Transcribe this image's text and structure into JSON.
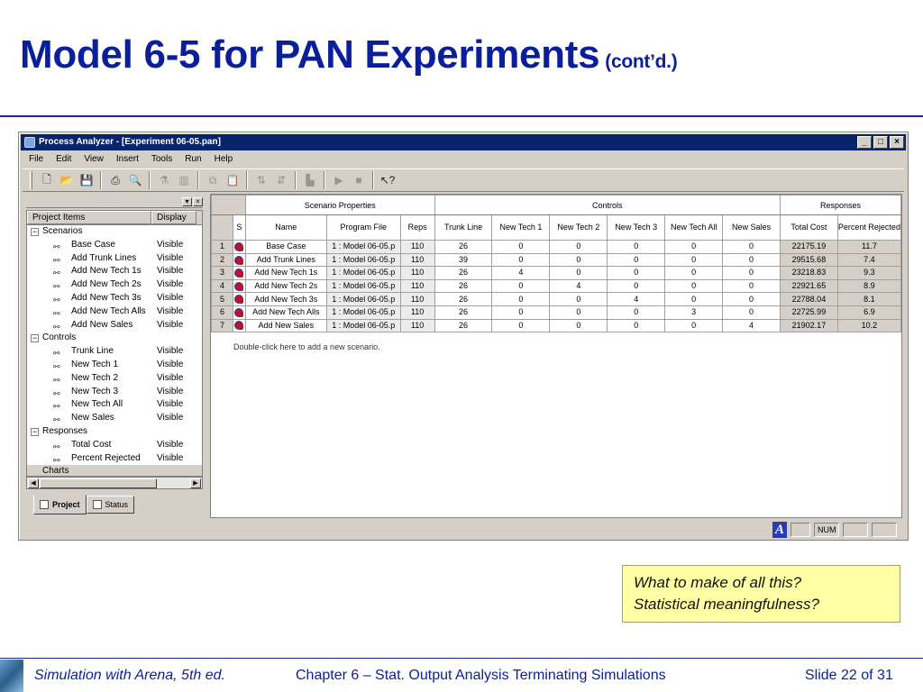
{
  "slide": {
    "title": "Model 6-5 for PAN Experiments",
    "title_suffix": "(cont’d.)"
  },
  "window": {
    "title": "Process Analyzer - [Experiment 06-05.pan]",
    "controls": {
      "minimize": "_",
      "maximize": "□",
      "close": "×"
    },
    "menu": [
      "File",
      "Edit",
      "View",
      "Insert",
      "Tools",
      "Run",
      "Help"
    ]
  },
  "toolbar": {
    "icons": [
      "new-icon",
      "open-icon",
      "save-icon",
      "print-icon",
      "print-preview-icon",
      "chart-wizard-icon",
      "insert-chart-icon",
      "copy-icon",
      "paste-icon",
      "sort-ascending-icon",
      "sort-descending-icon",
      "best-scenarios-icon",
      "run-icon",
      "stop-icon",
      "help-cursor-icon"
    ]
  },
  "project_tree": {
    "header": {
      "items": "Project Items",
      "display": "Display"
    },
    "groups": [
      {
        "label": "Scenarios",
        "items": [
          {
            "label": "Base Case",
            "display": "Visible"
          },
          {
            "label": "Add Trunk Lines",
            "display": "Visible"
          },
          {
            "label": "Add New Tech 1s",
            "display": "Visible"
          },
          {
            "label": "Add New Tech 2s",
            "display": "Visible"
          },
          {
            "label": "Add New Tech 3s",
            "display": "Visible"
          },
          {
            "label": "Add New Tech Alls",
            "display": "Visible"
          },
          {
            "label": "Add New Sales",
            "display": "Visible"
          }
        ]
      },
      {
        "label": "Controls",
        "items": [
          {
            "label": "Trunk Line",
            "display": "Visible"
          },
          {
            "label": "New Tech 1",
            "display": "Visible"
          },
          {
            "label": "New Tech 2",
            "display": "Visible"
          },
          {
            "label": "New Tech 3",
            "display": "Visible"
          },
          {
            "label": "New Tech All",
            "display": "Visible"
          },
          {
            "label": "New Sales",
            "display": "Visible"
          }
        ]
      },
      {
        "label": "Responses",
        "items": [
          {
            "label": "Total Cost",
            "display": "Visible"
          },
          {
            "label": "Percent Rejected",
            "display": "Visible"
          }
        ]
      }
    ],
    "charts_label": "Charts",
    "tabs": [
      "Project",
      "Status"
    ]
  },
  "grid": {
    "groups": {
      "scenario": "Scenario Properties",
      "controls": "Controls",
      "responses": "Responses"
    },
    "columns": [
      "S",
      "Name",
      "Program File",
      "Reps",
      "Trunk Line",
      "New Tech 1",
      "New Tech 2",
      "New Tech 3",
      "New Tech All",
      "New Sales",
      "Total Cost",
      "Percent Rejected"
    ],
    "rows": [
      {
        "n": "1",
        "name": "Base Case",
        "file": "1 : Model 06-05.p",
        "reps": "110",
        "trunk": "26",
        "t1": "0",
        "t2": "0",
        "t3": "0",
        "tall": "0",
        "sales": "0",
        "cost": "22175.19",
        "pct": "11.7"
      },
      {
        "n": "2",
        "name": "Add Trunk Lines",
        "file": "1 : Model 06-05.p",
        "reps": "110",
        "trunk": "39",
        "t1": "0",
        "t2": "0",
        "t3": "0",
        "tall": "0",
        "sales": "0",
        "cost": "29515.68",
        "pct": "7.4"
      },
      {
        "n": "3",
        "name": "Add New Tech 1s",
        "file": "1 : Model 06-05.p",
        "reps": "110",
        "trunk": "26",
        "t1": "4",
        "t2": "0",
        "t3": "0",
        "tall": "0",
        "sales": "0",
        "cost": "23218.83",
        "pct": "9.3"
      },
      {
        "n": "4",
        "name": "Add New Tech 2s",
        "file": "1 : Model 06-05.p",
        "reps": "110",
        "trunk": "26",
        "t1": "0",
        "t2": "4",
        "t3": "0",
        "tall": "0",
        "sales": "0",
        "cost": "22921.65",
        "pct": "8.9"
      },
      {
        "n": "5",
        "name": "Add New Tech 3s",
        "file": "1 : Model 06-05.p",
        "reps": "110",
        "trunk": "26",
        "t1": "0",
        "t2": "0",
        "t3": "4",
        "tall": "0",
        "sales": "0",
        "cost": "22788.04",
        "pct": "8.1"
      },
      {
        "n": "6",
        "name": "Add New Tech Alls",
        "file": "1 : Model 06-05.p",
        "reps": "110",
        "trunk": "26",
        "t1": "0",
        "t2": "0",
        "t3": "0",
        "tall": "3",
        "sales": "0",
        "cost": "22725.99",
        "pct": "6.9"
      },
      {
        "n": "7",
        "name": "Add New Sales",
        "file": "1 : Model 06-05.p",
        "reps": "110",
        "trunk": "26",
        "t1": "0",
        "t2": "0",
        "t3": "0",
        "tall": "0",
        "sales": "4",
        "cost": "21902.17",
        "pct": "10.2"
      }
    ],
    "hint": "Double-click here to add a new scenario."
  },
  "statusbar": {
    "font_indicator": "A",
    "num": "NUM"
  },
  "callout": {
    "line1": "What to make of all this?",
    "line2": "Statistical meaningfulness?"
  },
  "footer": {
    "book": "Simulation with Arena, 5th ed.",
    "chapter": "Chapter 6 – Stat. Output Analysis Terminating Simulations",
    "slide": "Slide 22 of 31"
  }
}
